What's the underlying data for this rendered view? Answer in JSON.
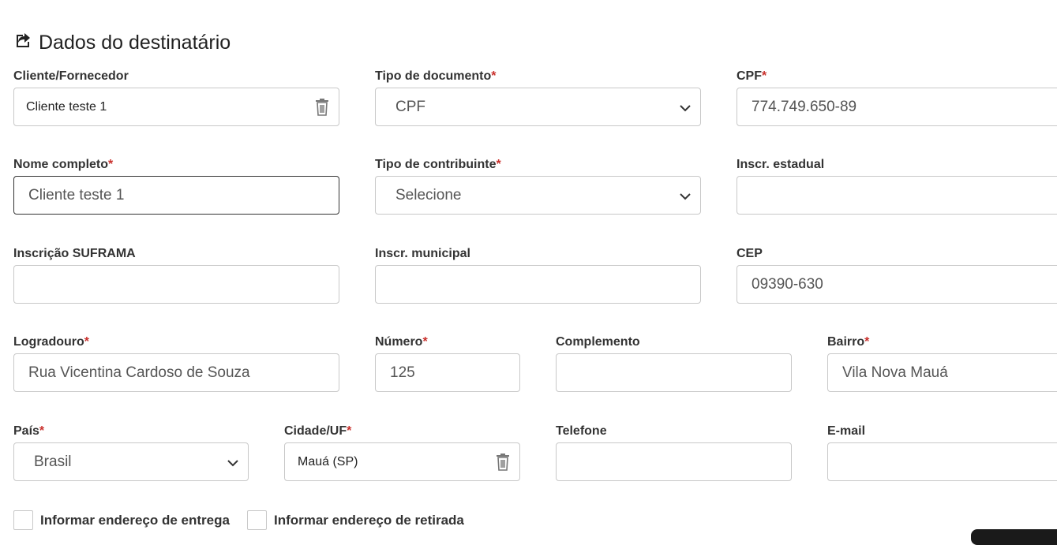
{
  "section": {
    "title": "Dados do destinatário",
    "icon": "share-square-icon"
  },
  "required_marker": "*",
  "fields": {
    "cliente": {
      "label": "Cliente/Fornecedor",
      "value": "Cliente teste 1"
    },
    "tipo_documento": {
      "label": "Tipo de documento",
      "value": "CPF"
    },
    "cpf": {
      "label": "CPF",
      "value": "774.749.650-89"
    },
    "nome": {
      "label": "Nome completo",
      "value": "Cliente teste 1"
    },
    "tipo_contribuinte": {
      "label": "Tipo de contribuinte",
      "value": "Selecione"
    },
    "inscr_estadual": {
      "label": "Inscr. estadual",
      "value": ""
    },
    "suframa": {
      "label": "Inscrição SUFRAMA",
      "value": ""
    },
    "inscr_municipal": {
      "label": "Inscr. municipal",
      "value": ""
    },
    "cep": {
      "label": "CEP",
      "value": "09390-630"
    },
    "logradouro": {
      "label": "Logradouro",
      "value": "Rua Vicentina Cardoso de Souza"
    },
    "numero": {
      "label": "Número",
      "value": "125"
    },
    "complemento": {
      "label": "Complemento",
      "value": ""
    },
    "bairro": {
      "label": "Bairro",
      "value": "Vila Nova Mauá"
    },
    "pais": {
      "label": "País",
      "value": "Brasil"
    },
    "cidade": {
      "label": "Cidade/UF",
      "value": "Mauá (SP)"
    },
    "telefone": {
      "label": "Telefone",
      "value": ""
    },
    "email": {
      "label": "E-mail",
      "value": ""
    }
  },
  "checkboxes": {
    "entrega": {
      "label": "Informar endereço de entrega",
      "checked": false
    },
    "retirada": {
      "label": "Informar endereço de retirada",
      "checked": false
    }
  },
  "colors": {
    "required": "#c9302c",
    "border": "#c8c8c8",
    "focus_border": "#333333"
  }
}
